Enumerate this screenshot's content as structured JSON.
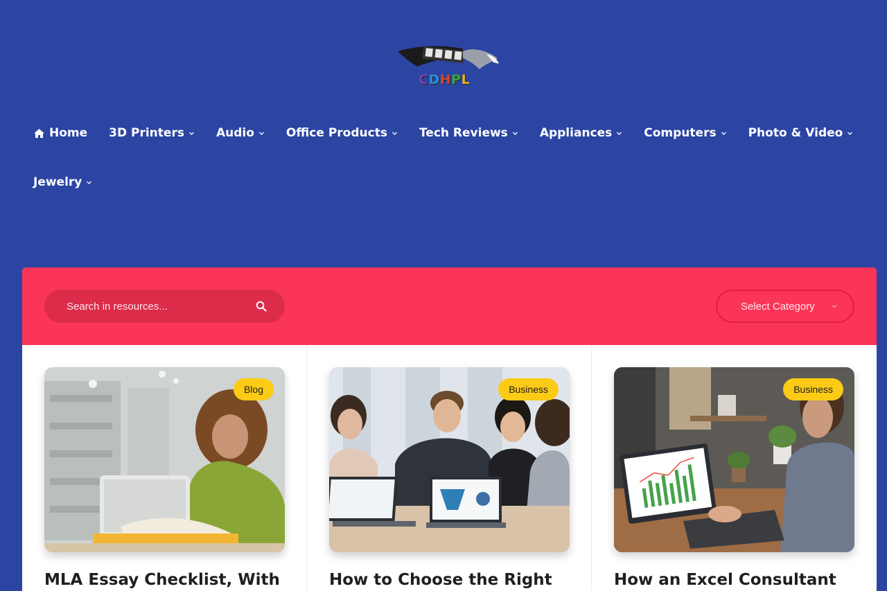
{
  "brand": {
    "logo_text": "CDHPL"
  },
  "nav": {
    "row1": [
      {
        "label": "Home"
      },
      {
        "label": "3D Printers"
      },
      {
        "label": "Audio"
      },
      {
        "label": "Office Products"
      },
      {
        "label": "Tech Reviews"
      },
      {
        "label": "Appliances"
      },
      {
        "label": "Computers"
      },
      {
        "label": "Photo & Video"
      }
    ],
    "row2": [
      {
        "label": "Jewelry"
      }
    ]
  },
  "filter": {
    "search_placeholder": "Search in resources...",
    "category_label": "Select Category"
  },
  "cards": [
    {
      "badge": "Blog",
      "title": "MLA Essay Checklist, With"
    },
    {
      "badge": "Business",
      "title": "How to Choose the Right"
    },
    {
      "badge": "Business",
      "title": "How an Excel Consultant"
    }
  ],
  "icons": [
    "home-icon",
    "chevron-down-icon",
    "search-icon",
    "eagle-logo"
  ],
  "colors": {
    "background": "#2c45a3",
    "accent": "#fb3557",
    "badge": "#fbcb16"
  }
}
